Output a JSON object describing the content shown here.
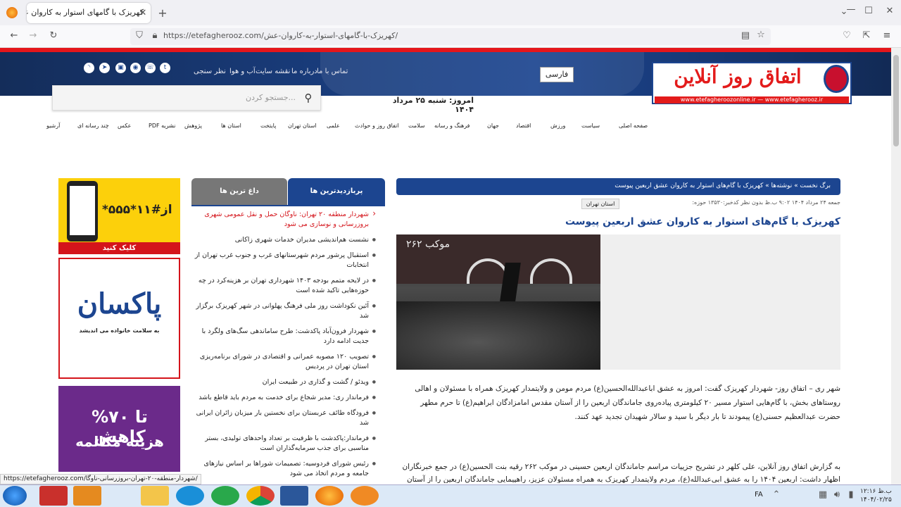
{
  "browser": {
    "tab_title": "کهریزک با گامهای استوار به کاروان عش...",
    "url": "https://etefagherooz.com/کهریزک-با-گامهای-استوار-به-کاروان-عش/"
  },
  "header": {
    "logo_text": "اتفاق روز آنلاین",
    "logo_strip": "www.etefagheroozonline.ir — www.etefagherooz.ir",
    "lang": "فارسی",
    "top_links": [
      "تماس با ما",
      "درباره ما",
      "نقشه سایت",
      "آب و هوا",
      "نظر سنجی"
    ],
    "search_placeholder": "جستجو کردن...",
    "date": "امروز: شنبه ۲۵ مرداد ۱۴۰۴",
    "nav": [
      "صفحه اصلی",
      "سیاست",
      "ورزش",
      "اقتصاد",
      "جهان",
      "فرهنگ و رسانه",
      "سلامت",
      "اتفاق روز و حوادث",
      "علمی",
      "استان تهران",
      "پایتخت",
      "استان ها",
      "پژوهش",
      "PDF نشریه",
      "عکس",
      "چند رسانه ای",
      "آرشیو"
    ]
  },
  "article": {
    "breadcrumb": "برگ نخست  »  نوشته‌ها  »  کهریزک با گام‌های استوار به کاروان عشق اربعین پیوست",
    "meta": "جمعه ۲۴ مرداد ۱۴۰۴   ۹:۰۲ ب.ظ   بدون نظر   کدخبر:۱۳۵۳۰   حوزه:",
    "region": "استان تهران",
    "title": "کهریزک با گام‌های استوار به کاروان عشق اربعین پیوست",
    "para1": "شهر ری – اتفاق روز- شهردار کهریزک گفت: امروز به عشق اباعبدالله‌الحسین(ع) مردم مومن و ولایتمدار کهریزک همراه با مسئولان و اهالی روستاهای بخش، با گام‌هایی استوار مسیر ۲۰ کیلومتری پیاده‌روی جاماندگان اربعین را از آستان مقدس امامزادگان ابراهیم(ع) تا حرم مطهر حضرت عبدالعظیم حسنی(ع) پیمودند تا بار دیگر با سید و سالار شهیدان تجدید عهد کنند.",
    "para2": "به گزارش اتفاق روز آنلاین، علی کلهر در تشریح جزییات مراسم جاماندگان اربعین حسینی در موکب ۲۶۲ رقیه بنت الحسین(ع) در جمع خبرنگاران اظهار داشت: اربعین ۱۴۰۴ را به عشق ابی‌عبدالله(ع)، مردم ولایتمدار کهریزک به همراه مسئولان عزیز، راهپیمایی جاماندگان اربعین را از آستان مقدس"
  },
  "sidebar": {
    "tab_most": "پربازدیدترین ها",
    "tab_hot": "داغ ترین ها",
    "items": [
      "شهردار منطقه ۲۰ تهران: ناوگان حمل و نقل عمومی شهری بروزرسانی و نوسازی می شود",
      "نشست هم‌اندیشی مدیران خدمات شهری زاکانی",
      "استقبال پرشور مردم شهرستانهای غرب و جنوب غرب تهران از انتخابات",
      "در لایحه متمم بودجه ۱۴۰۳ شهرداری تهران بر هزینه‌کرد در چه حوزه‌هایی تاکید شده است",
      "آئین نکوداشت روز ملی فرهنگ پهلوانی در شهر کهریزک برگزار شد",
      "شهردار فرون‌آباد پاکدشت: طرح ساماندهی سگ‌های ولگرد با جدیت ادامه دارد",
      "تصویب ۱۲۰ مصوبه عمرانی و اقتصادی در شورای برنامه‌ریزی استان تهران در پردیس",
      "ویدئو / گشت و گذاری در طبیعت ایران",
      "فرماندار ری: مدیر شجاع برای خدمت به مردم باید قاطع باشد",
      "فرودگاه طائف عربستان برای نخستین بار میزبان زائران ایرانی شد",
      "فرماندار:پاکدشت با ظرفیت بر تعداد واحدهای تولیدی، بستر مناسبی برای جذب سرمایه‌گذاران است",
      "رئیس شورای فردوسیه: تصمیمات شوراها بر اساس نیازهای جامعه و مردم اتخاذ می شود"
    ]
  },
  "ads": {
    "ad1_code": "*۵۵۵*۱۱#از",
    "ad1_cta": "کلیک کنید",
    "ad2_brand": "پاکسان",
    "ad2_tag": "به سلامت خانواده می اندیشد",
    "ad3_t1": "تا ۷۰% کاهش",
    "ad3_t2": "هزینه مکالمه"
  },
  "photo": {
    "banner": "موکب ۲۶۲"
  },
  "status_url": "https://etefagherooz.com/شهردار-منطقه-۲۰-تهران-بروزرسانی-ناوگا/",
  "taskbar": {
    "lang": "FA",
    "time": "ب.ظ ۱۲:۱۶",
    "date": "۱۴۰۴/۰۲/۲۵"
  }
}
